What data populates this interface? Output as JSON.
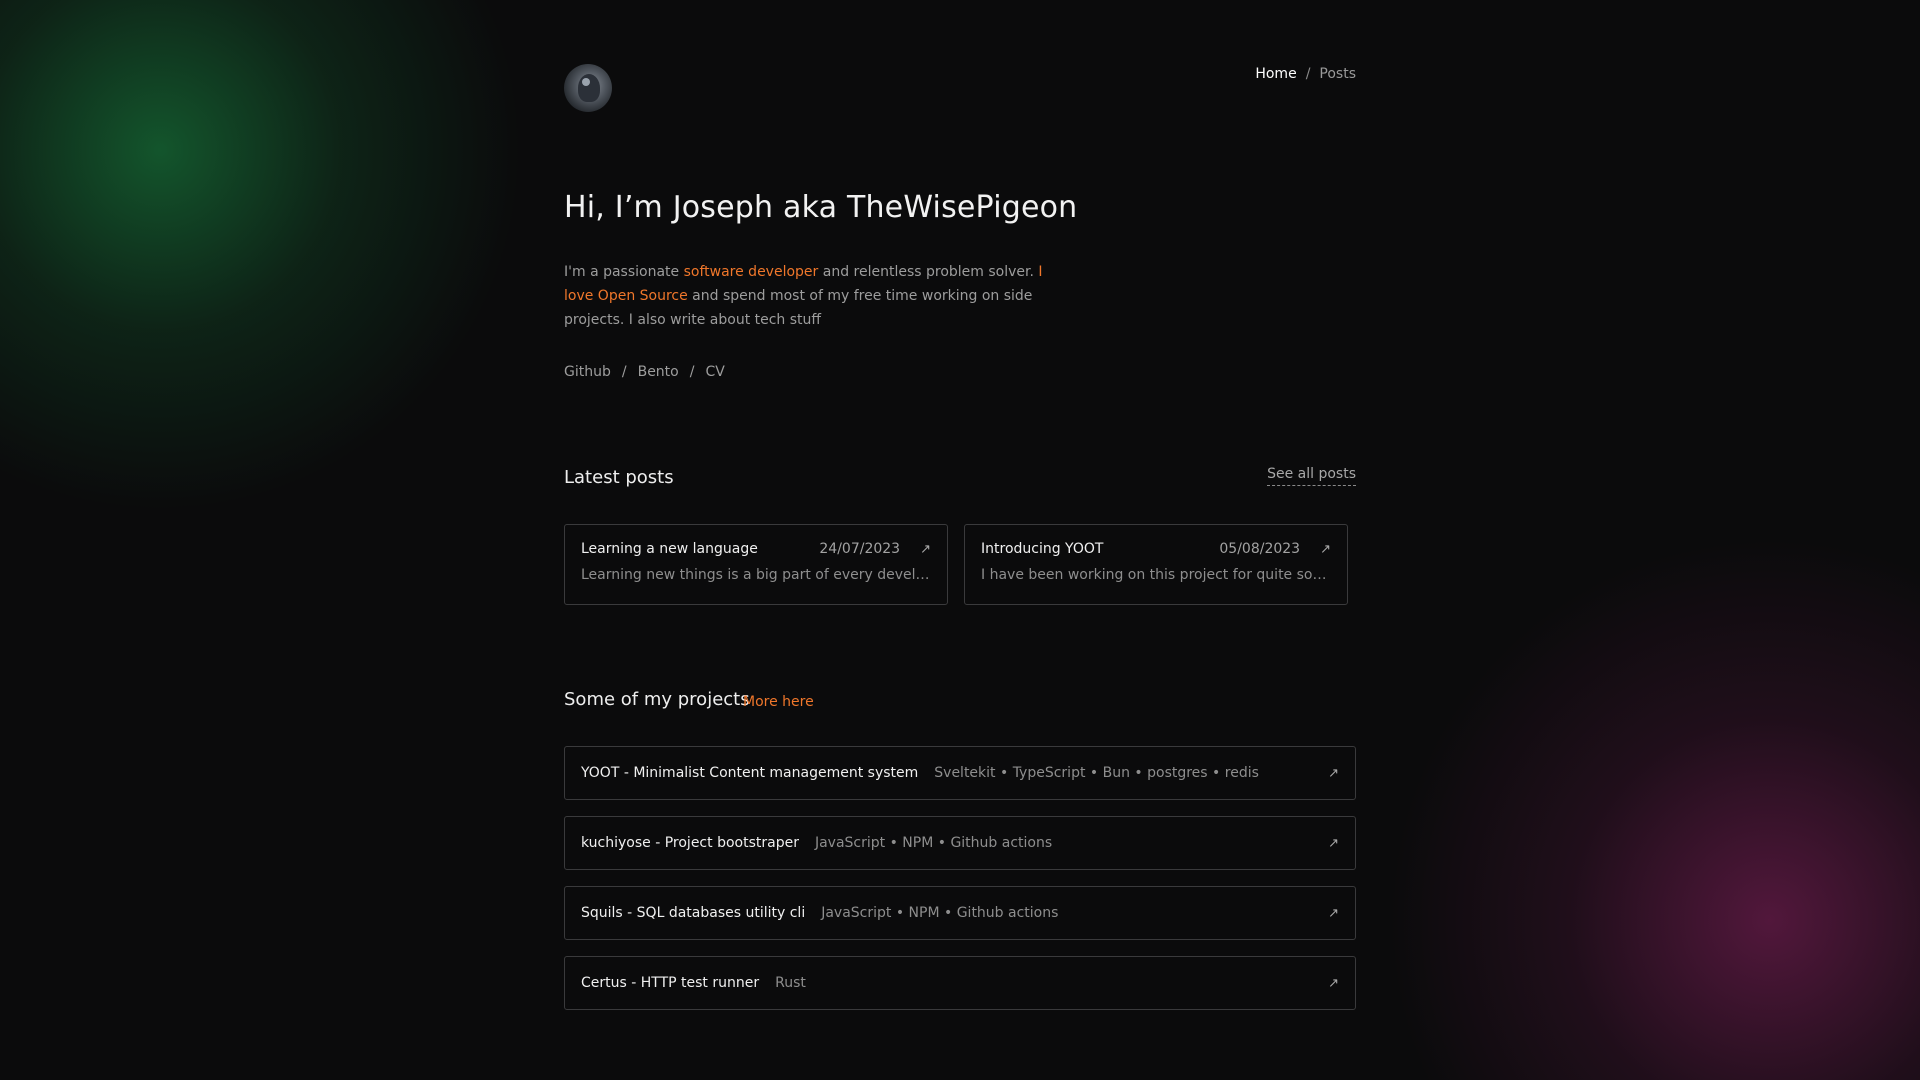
{
  "nav": {
    "home": "Home",
    "separator": "/",
    "posts": "Posts"
  },
  "hero": {
    "title": "Hi, I’m Joseph aka TheWisePigeon",
    "intro_1": "I'm a passionate ",
    "intro_accent_1": "software developer",
    "intro_2": " and relentless problem solver. ",
    "intro_accent_2": "I love Open Source",
    "intro_3": " and spend most of my free time working on side projects. I also write about tech stuff"
  },
  "social_links": {
    "items": [
      "Github",
      "Bento",
      "CV"
    ],
    "separator": "/"
  },
  "latest_posts": {
    "heading": "Latest posts",
    "see_all": "See all posts",
    "posts": [
      {
        "title": "Learning a new language",
        "date": "24/07/2023",
        "excerpt": "Learning new things is a big part of every developer's journey"
      },
      {
        "title": "Introducing YOOT",
        "date": "05/08/2023",
        "excerpt": "I have been working on this project for quite some time now"
      }
    ]
  },
  "projects": {
    "heading": "Some of my projects",
    "more": "More here",
    "items": [
      {
        "name": "YOOT - Minimalist Content management system",
        "tags": "Sveltekit • TypeScript • Bun • postgres • redis"
      },
      {
        "name": "kuchiyose - Project bootstraper",
        "tags": "JavaScript • NPM • Github actions"
      },
      {
        "name": "Squils - SQL databases utility cli",
        "tags": "JavaScript • NPM • Github actions"
      },
      {
        "name": "Certus - HTTP test runner",
        "tags": "Rust"
      }
    ]
  },
  "icons": {
    "external_link": "arrow-up-right-icon",
    "avatar": "pigeon-avatar"
  },
  "colors": {
    "background": "#0b0b0c",
    "accent": "#f0772b",
    "glow_green": "#166e37",
    "glow_magenta": "#781e55"
  }
}
